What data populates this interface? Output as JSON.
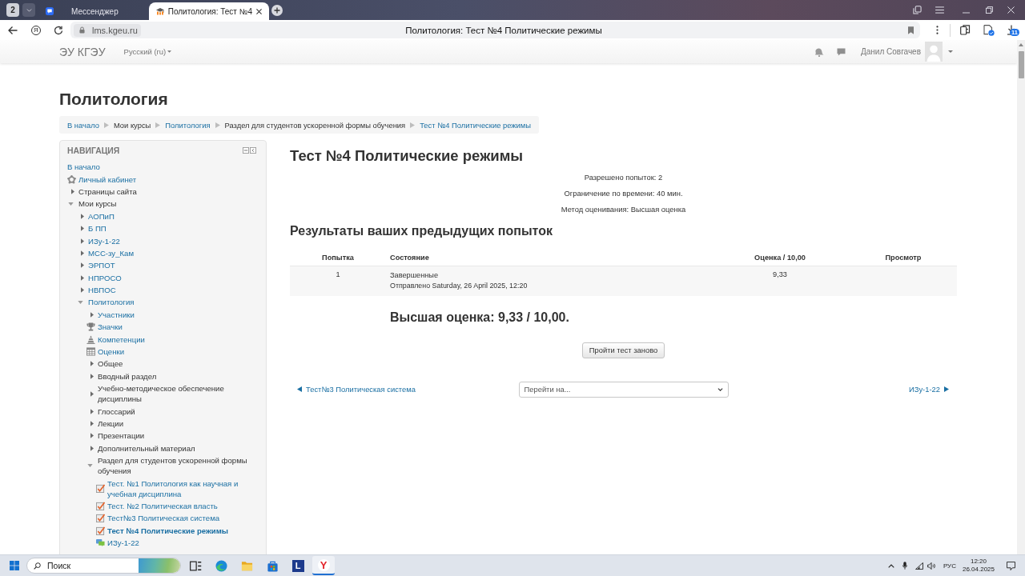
{
  "browser": {
    "tab_count": "2",
    "tabs": [
      {
        "kind": "messenger",
        "title": "Мессенджер",
        "selected": false
      },
      {
        "kind": "site",
        "title": "Политология: Тест №4",
        "selected": true
      }
    ],
    "toolbar": {
      "home_letter": "Я",
      "host": "lms.kgeu.ru",
      "page_title": "Политология: Тест №4 Политические режимы",
      "downloads_count": "11"
    }
  },
  "site_header": {
    "brand": "ЭУ КГЭУ",
    "language": "Русский (ru)",
    "user_name": "Данил Совгачев"
  },
  "page": {
    "heading": "Политология",
    "breadcrumb": [
      {
        "label": "В начало",
        "link": true
      },
      {
        "label": "Мои курсы",
        "link": false
      },
      {
        "label": "Политология",
        "link": true
      },
      {
        "label": "Раздел для студентов ускоренной формы обучения",
        "link": false
      },
      {
        "label": "Тест №4 Политические режимы",
        "link": true
      }
    ]
  },
  "navigation": {
    "title": "НАВИГАЦИЯ",
    "items": [
      {
        "label": "В начало",
        "kind": "link",
        "link": true
      },
      {
        "label": "Личный кабинет",
        "kind": "dashboard",
        "link": true
      },
      {
        "label": "Страницы сайта",
        "kind": "branch",
        "link": false,
        "expanded": false
      },
      {
        "label": "Мои курсы",
        "kind": "branch",
        "link": false,
        "expanded": true,
        "children": [
          {
            "label": "АОПиП",
            "kind": "branch",
            "link": true,
            "expanded": false
          },
          {
            "label": "Б ПП",
            "kind": "branch",
            "link": true,
            "expanded": false
          },
          {
            "label": "ИЗу-1-22",
            "kind": "branch",
            "link": true,
            "expanded": false
          },
          {
            "label": "МСС-зу_Кам",
            "kind": "branch",
            "link": true,
            "expanded": false
          },
          {
            "label": "ЭРПОТ",
            "kind": "branch",
            "link": true,
            "expanded": false
          },
          {
            "label": "НПРОСО",
            "kind": "branch",
            "link": true,
            "expanded": false
          },
          {
            "label": "НВПОС",
            "kind": "branch",
            "link": true,
            "expanded": false
          },
          {
            "label": "Политология",
            "kind": "branch",
            "link": true,
            "expanded": true,
            "children": [
              {
                "label": "Участники",
                "kind": "branch",
                "link": true,
                "expanded": false
              },
              {
                "label": "Значки",
                "kind": "badges",
                "link": true
              },
              {
                "label": "Компетенции",
                "kind": "competencies",
                "link": true
              },
              {
                "label": "Оценки",
                "kind": "grades",
                "link": true
              },
              {
                "label": "Общее",
                "kind": "branch",
                "link": false,
                "expanded": false
              },
              {
                "label": "Вводный раздел",
                "kind": "branch",
                "link": false,
                "expanded": false
              },
              {
                "label": "Учебно-методическое обеспечение дисциплины",
                "kind": "branch",
                "link": false,
                "expanded": false
              },
              {
                "label": "Глоссарий",
                "kind": "branch",
                "link": false,
                "expanded": false
              },
              {
                "label": "Лекции",
                "kind": "branch",
                "link": false,
                "expanded": false
              },
              {
                "label": "Презентации",
                "kind": "branch",
                "link": false,
                "expanded": false
              },
              {
                "label": "Дополнительный материал",
                "kind": "branch",
                "link": false,
                "expanded": false
              },
              {
                "label": "Раздел для студентов ускоренной формы обучения",
                "kind": "branch",
                "link": false,
                "expanded": true,
                "children": [
                  {
                    "label": "Тест. №1 Политология как научная и учебная дисциплина",
                    "kind": "quiz",
                    "link": true,
                    "selected": false
                  },
                  {
                    "label": "Тест. №2 Политическая власть",
                    "kind": "quiz",
                    "link": true,
                    "selected": false
                  },
                  {
                    "label": "Тест№3 Политическая система",
                    "kind": "quiz",
                    "link": true,
                    "selected": false
                  },
                  {
                    "label": "Тест №4 Политические режимы",
                    "kind": "quiz",
                    "link": true,
                    "selected": true
                  },
                  {
                    "label": "ИЗу-1-22",
                    "kind": "forum",
                    "link": true,
                    "selected": false
                  }
                ]
              }
            ]
          }
        ]
      }
    ]
  },
  "quiz": {
    "title": "Тест №4 Политические режимы",
    "info": [
      "Разрешено попыток: 2",
      "Ограничение по времени: 40 мин.",
      "Метод оценивания: Высшая оценка"
    ],
    "results_heading": "Результаты ваших предыдущих попыток",
    "table": {
      "columns": [
        "Попытка",
        "Состояние",
        "Оценка / 10,00",
        "Просмотр"
      ],
      "rows": [
        {
          "attempt": "1",
          "state": "Завершенные",
          "submitted": "Отправлено Saturday, 26 April 2025, 12:20",
          "grade": "9,33"
        }
      ]
    },
    "highest_grade": "Высшая оценка: 9,33 / 10,00.",
    "retake_button": "Пройти тест заново",
    "prev_link": "Тест№3 Политическая система",
    "jump_select": "Перейти на...",
    "next_link": "ИЗу-1-22"
  },
  "taskbar": {
    "search_placeholder": "Поиск",
    "apps": [
      {
        "kind": "task-view",
        "active": false
      },
      {
        "kind": "swirl",
        "active": false
      },
      {
        "kind": "folder",
        "active": false
      },
      {
        "kind": "bag",
        "active": false
      },
      {
        "kind": "letter",
        "letter": "L",
        "active": false
      },
      {
        "kind": "round-letter",
        "letter": "Y",
        "active": true
      }
    ],
    "tray": {
      "language": "РУС",
      "time": "12:20",
      "date": "26.04.2025"
    }
  }
}
